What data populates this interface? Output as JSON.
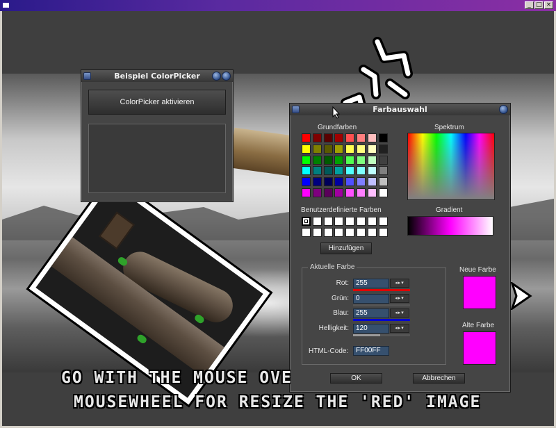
{
  "window": {
    "buttons": {
      "minimize": "_",
      "maximize": "□",
      "close": "×"
    }
  },
  "demo_window": {
    "title": "Beispiel ColorPicker",
    "activate_button": "ColorPicker aktivieren"
  },
  "color_dialog": {
    "title": "Farbauswahl",
    "basic_colors_label": "Grundfarben",
    "spectrum_label": "Spektrum",
    "custom_colors_label": "Benutzerdefinierte Farben",
    "gradient_label": "Gradient",
    "add_button": "Hinzufügen",
    "current_color_legend": "Aktuelle Farbe",
    "new_color_label": "Neue Farbe",
    "old_color_label": "Alte Farbe",
    "rows": [
      {
        "label": "Rot:",
        "value": "255",
        "bar_color": "#e00000",
        "level": 1.0
      },
      {
        "label": "Grün:",
        "value": "0",
        "bar_color": "#00a000",
        "level": 0.0
      },
      {
        "label": "Blau:",
        "value": "255",
        "bar_color": "#0000d0",
        "level": 1.0
      },
      {
        "label": "Helligkeit:",
        "value": "120",
        "bar_color": "#9a9a9a",
        "level": 0.47
      }
    ],
    "html_code_label": "HTML-Code:",
    "html_code_value": "FF00FF",
    "spin_glyph": "◂▸▾",
    "ok_button": "OK",
    "cancel_button": "Abbrechen",
    "new_color": "#ff00ff",
    "old_color": "#ff00ff",
    "basic_colors": [
      [
        "#ff0000",
        "#7f0000",
        "#5a0000",
        "#a00000",
        "#ff5050",
        "#ff7f7f",
        "#ffbfbf",
        "#000000"
      ],
      [
        "#ffff00",
        "#7f7f00",
        "#5a5a00",
        "#a0a000",
        "#ffff50",
        "#ffff7f",
        "#ffffbf",
        "#202020"
      ],
      [
        "#00ff00",
        "#007f00",
        "#005a00",
        "#00a000",
        "#50ff50",
        "#7fff7f",
        "#bfffbf",
        "#404040"
      ],
      [
        "#00ffff",
        "#007f7f",
        "#005a5a",
        "#00a0a0",
        "#50ffff",
        "#7fffff",
        "#bfffff",
        "#808080"
      ],
      [
        "#0000ff",
        "#00007f",
        "#00005a",
        "#0000a0",
        "#5050ff",
        "#7f7fff",
        "#bfbfff",
        "#bfbfbf"
      ],
      [
        "#ff00ff",
        "#7f007f",
        "#5a005a",
        "#a000a0",
        "#ff50ff",
        "#ff7fff",
        "#ffbfff",
        "#ffffff"
      ]
    ],
    "custom_colors": [
      [
        "#ffffff",
        "#ffffff",
        "#ffffff",
        "#ffffff",
        "#ffffff",
        "#ffffff",
        "#ffffff",
        "#ffffff"
      ],
      [
        "#ffffff",
        "#ffffff",
        "#ffffff",
        "#ffffff",
        "#ffffff",
        "#ffffff",
        "#ffffff",
        "#ffffff"
      ]
    ]
  },
  "banners": {
    "line1": "GO WITH THE MOUSE OVE",
    "line2": "MOUSEWHEEL FOR RESIZE THE 'RED' IMAGE"
  },
  "icons": {
    "window_icon": "window-icon",
    "gui_window_icon": "gui-window-icon",
    "close_round": "close-round-icon",
    "minimize_round": "minimize-round-icon"
  }
}
